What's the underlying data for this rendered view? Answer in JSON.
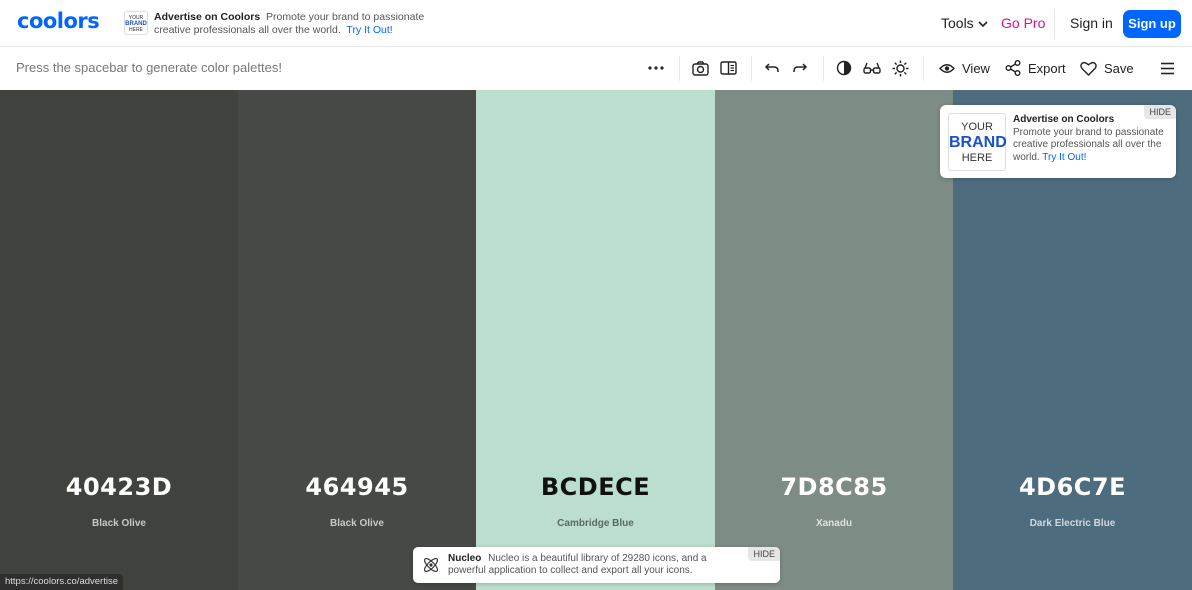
{
  "brand": {
    "logo_text": "coolors",
    "accent": "#0066ff"
  },
  "top_ad": {
    "logo_lines": [
      "YOUR",
      "BRAND",
      "HERE"
    ],
    "title": "Advertise on Coolors",
    "body": "Promote your brand to passionate creative professionals all over the world.",
    "link": "Try It Out!"
  },
  "nav": {
    "tools": "Tools",
    "go_pro": "Go Pro",
    "sign_in": "Sign in",
    "sign_up": "Sign up"
  },
  "toolbar": {
    "hint": "Press the spacebar to generate color palettes!",
    "view": "View",
    "export": "Export",
    "save": "Save",
    "icons": [
      "more-icon",
      "camera-icon",
      "split-view-icon",
      "undo-icon",
      "redo-icon",
      "contrast-icon",
      "glasses-icon",
      "brightness-icon",
      "eye-icon",
      "share-icon",
      "heart-icon",
      "menu-icon"
    ]
  },
  "palette": [
    {
      "hex": "40423D",
      "name": "Black Olive",
      "color": "#40423d",
      "text_color": "#ffffff",
      "name_color": "#c8c8c4"
    },
    {
      "hex": "464945",
      "name": "Black Olive",
      "color": "#464945",
      "text_color": "#ffffff",
      "name_color": "#c8c9c6"
    },
    {
      "hex": "BCDECE",
      "name": "Cambridge Blue",
      "color": "#bcdece",
      "text_color": "#111111",
      "name_color": "#5a6a62"
    },
    {
      "hex": "7D8C85",
      "name": "Xanadu",
      "color": "#7d8c85",
      "text_color": "#ffffff",
      "name_color": "#dde2df"
    },
    {
      "hex": "4D6C7E",
      "name": "Dark Electric Blue",
      "color": "#4d6c7e",
      "text_color": "#ffffff",
      "name_color": "#cfd9df"
    }
  ],
  "side_ad": {
    "logo_lines": [
      "YOUR",
      "BRAND",
      "HERE"
    ],
    "title": "Advertise on Coolors",
    "body": "Promote your brand to passionate creative professionals all over the world.",
    "link": "Try It Out!",
    "hide": "HIDE"
  },
  "bottom_ad": {
    "title": "Nucleo",
    "body": "Nucleo is a beautiful library of 29280 icons, and a powerful application to collect and export all your icons.",
    "hide": "HIDE"
  },
  "status_url": "https://coolors.co/advertise"
}
